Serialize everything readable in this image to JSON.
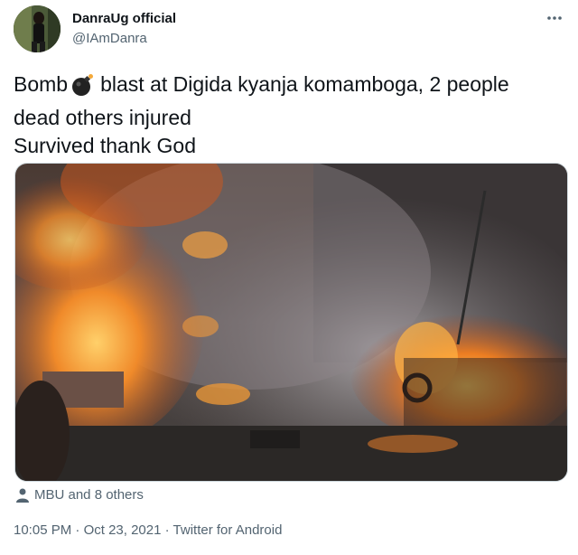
{
  "author": {
    "name": "DanraUg official",
    "handle": "@IAmDanra"
  },
  "tweet": {
    "line1_before": "Bomb",
    "line1_after": "blast at Digida kyanja komamboga,  2 people",
    "line2": "dead others injured",
    "line3": "Survived thank God"
  },
  "tagged": {
    "text": "MBU and 8 others"
  },
  "meta": {
    "time": "10:05 PM",
    "separator": " · ",
    "date": "Oct 23, 2021",
    "source": "Twitter for Android"
  },
  "icons": {
    "more": "more-horizontal-icon",
    "bomb": "bomb-emoji",
    "person": "person-icon"
  },
  "colors": {
    "text": "#0f1419",
    "secondary": "#536471",
    "border": "#cfd9de"
  }
}
